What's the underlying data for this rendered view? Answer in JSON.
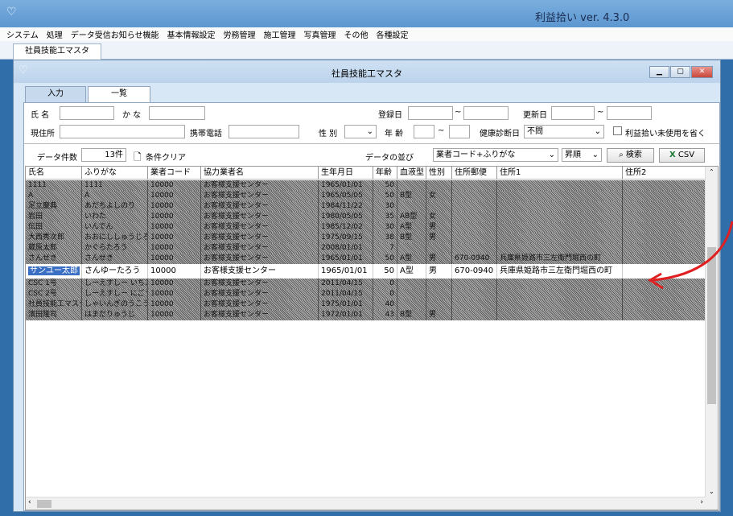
{
  "app": {
    "title": "利益拾い ver. 4.3.0"
  },
  "menu": [
    "システム",
    "処理",
    "データ受信お知らせ機能",
    "基本情報設定",
    "労務管理",
    "施工管理",
    "写真管理",
    "その他",
    "各種設定"
  ],
  "doc_tab": "社員技能工マスタ",
  "window": {
    "title": "社員技能工マスタ",
    "tabs": [
      "入力",
      "一覧"
    ]
  },
  "search": {
    "name_label": "氏 名",
    "kana_label": "か な",
    "reg_date_label": "登録日",
    "upd_date_label": "更新日",
    "tilde": "~",
    "address_label": "現住所",
    "phone_label": "携帯電話",
    "gender_label": "性 別",
    "age_label": "年 齢",
    "health_label": "健康診断日",
    "health_value": "不問",
    "unused_check_label": "利益拾い未使用を省く",
    "count_label": "データ件数",
    "count_value": "13件",
    "clear_label": "条件クリア",
    "sort_label": "データの並び",
    "sort_value": "業者コード+ふりがな",
    "order_value": "昇順",
    "search_btn": "検索",
    "csv_btn": "CSV"
  },
  "columns": [
    "氏名",
    "ふりがな",
    "業者コード",
    "協力業者名",
    "生年月日",
    "年齢",
    "血液型",
    "性別",
    "住所郵便",
    "住所1",
    "住所2"
  ],
  "rows": [
    {
      "name": "1111",
      "kana": "1111",
      "code": "10000",
      "company": "お客様支援センター",
      "birth": "1965/01/01",
      "age": "50",
      "blood": "",
      "sex": "",
      "zip": "",
      "addr": "",
      "hatch": true
    },
    {
      "name": "A",
      "kana": "A",
      "code": "10000",
      "company": "お客様支援センター",
      "birth": "1965/05/05",
      "age": "50",
      "blood": "B型",
      "sex": "女",
      "zip": "",
      "addr": "",
      "hatch": true
    },
    {
      "name": "足立慶典",
      "kana": "あだちよしのり",
      "code": "10000",
      "company": "お客様支援センター",
      "birth": "1984/11/22",
      "age": "30",
      "blood": "",
      "sex": "",
      "zip": "",
      "addr": "",
      "hatch": true
    },
    {
      "name": "岩田",
      "kana": "いわた",
      "code": "10000",
      "company": "お客様支援センター",
      "birth": "1980/05/05",
      "age": "35",
      "blood": "AB型",
      "sex": "女",
      "zip": "",
      "addr": "",
      "hatch": true
    },
    {
      "name": "伝田",
      "kana": "いんでん",
      "code": "10000",
      "company": "お客様支援センター",
      "birth": "1985/12/02",
      "age": "30",
      "blood": "A型",
      "sex": "男",
      "zip": "",
      "addr": "",
      "hatch": true
    },
    {
      "name": "大西秀次郎",
      "kana": "おおにししゅうじろう",
      "code": "10000",
      "company": "お客様支援センター",
      "birth": "1975/09/15",
      "age": "38",
      "blood": "B型",
      "sex": "男",
      "zip": "",
      "addr": "",
      "hatch": true
    },
    {
      "name": "蔵原太郎",
      "kana": "かぐらたろう",
      "code": "10000",
      "company": "お客様支援センター",
      "birth": "2008/01/01",
      "age": "7",
      "blood": "",
      "sex": "",
      "zip": "",
      "addr": "",
      "hatch": true
    },
    {
      "name": "さんせき",
      "kana": "さんせき",
      "code": "10000",
      "company": "お客様支援センター",
      "birth": "1965/01/01",
      "age": "50",
      "blood": "A型",
      "sex": "男",
      "zip": "670-0940",
      "addr": "兵庫県姫路市三左衛門堀西の町",
      "hatch": true
    },
    {
      "name": "サンユー太郎",
      "kana": "さんゆーたろう",
      "code": "10000",
      "company": "お客様支援センター",
      "birth": "1965/01/01",
      "age": "50",
      "blood": "A型",
      "sex": "男",
      "zip": "670-0940",
      "addr": "兵庫県姫路市三左衛門堀西の町",
      "hatch": false
    },
    {
      "name": "CSC 1号",
      "kana": "しーえすしー いちごう",
      "code": "10000",
      "company": "お客様支援センター",
      "birth": "2011/04/15",
      "age": "0",
      "blood": "",
      "sex": "",
      "zip": "",
      "addr": "",
      "hatch": true
    },
    {
      "name": "CSC 2号",
      "kana": "しーえすしー にごう",
      "code": "10000",
      "company": "お客様支援センター",
      "birth": "2011/04/15",
      "age": "0",
      "blood": "",
      "sex": "",
      "zip": "",
      "addr": "",
      "hatch": true
    },
    {
      "name": "社員技能工マスタ",
      "kana": "しゃいんぎのうこう",
      "code": "10000",
      "company": "お客様支援センター",
      "birth": "1975/01/01",
      "age": "40",
      "blood": "",
      "sex": "",
      "zip": "",
      "addr": "",
      "hatch": true
    },
    {
      "name": "濱田隆司",
      "kana": "はまだりゅうじ",
      "code": "10000",
      "company": "お客様支援センター",
      "birth": "1972/01/01",
      "age": "43",
      "blood": "B型",
      "sex": "男",
      "zip": "",
      "addr": "",
      "hatch": true
    }
  ],
  "colors": {
    "titlebar": "#5d97d0",
    "highlight": "#3b6fc4",
    "arrow": "#e02020"
  }
}
